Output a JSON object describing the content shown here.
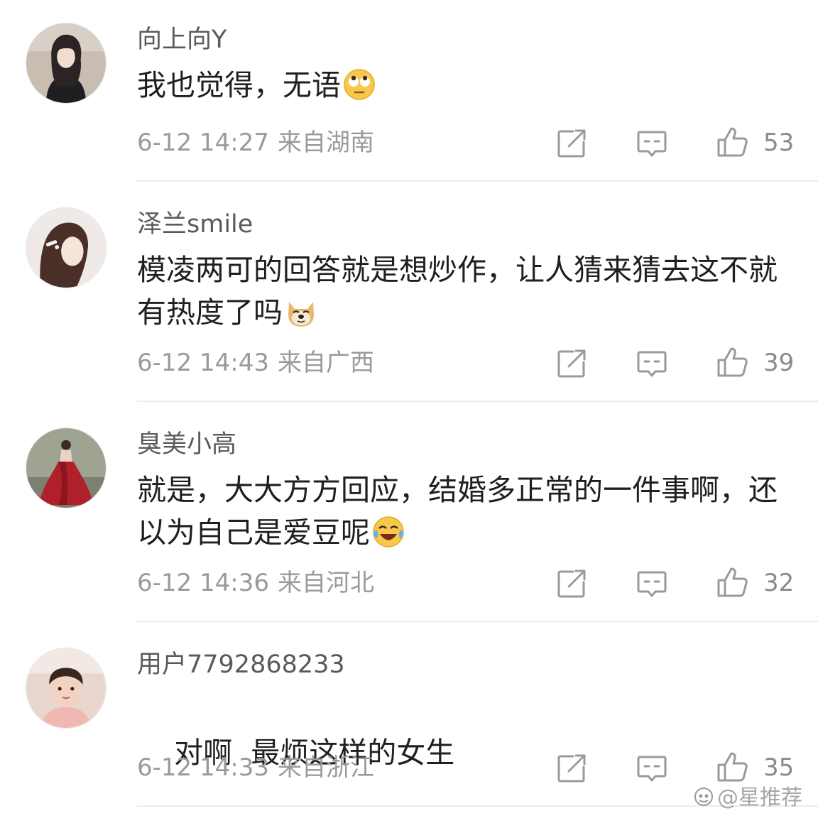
{
  "comments": [
    {
      "username": "向上向Y",
      "text": "我也觉得，无语",
      "emoji": "rolling-eyes-emoji",
      "time": "6-12 14:27",
      "location": "来自湖南",
      "likes": "53"
    },
    {
      "username": "泽兰smile",
      "text": "模凌两可的回答就是想炒作，让人猜来猜去这不就有热度了吗",
      "emoji": "doge-emoji",
      "time": "6-12 14:43",
      "location": "来自广西",
      "likes": "39"
    },
    {
      "username": "臭美小高",
      "text": "就是，大大方方回应，结婚多正常的一件事啊，还以为自己是爱豆呢",
      "emoji": "laugh-cry-emoji",
      "time": "6-12 14:36",
      "location": "来自河北",
      "likes": "32"
    },
    {
      "username": "用户7792868233",
      "text": "对啊  最烦这样的女生",
      "emoji": "",
      "time": "6-12 14:33",
      "location": "来自浙江",
      "likes": "35"
    }
  ],
  "icons": {
    "share": "share-icon",
    "reply": "comment-icon",
    "like": "thumbs-up-icon"
  },
  "watermark": "@星推荐"
}
